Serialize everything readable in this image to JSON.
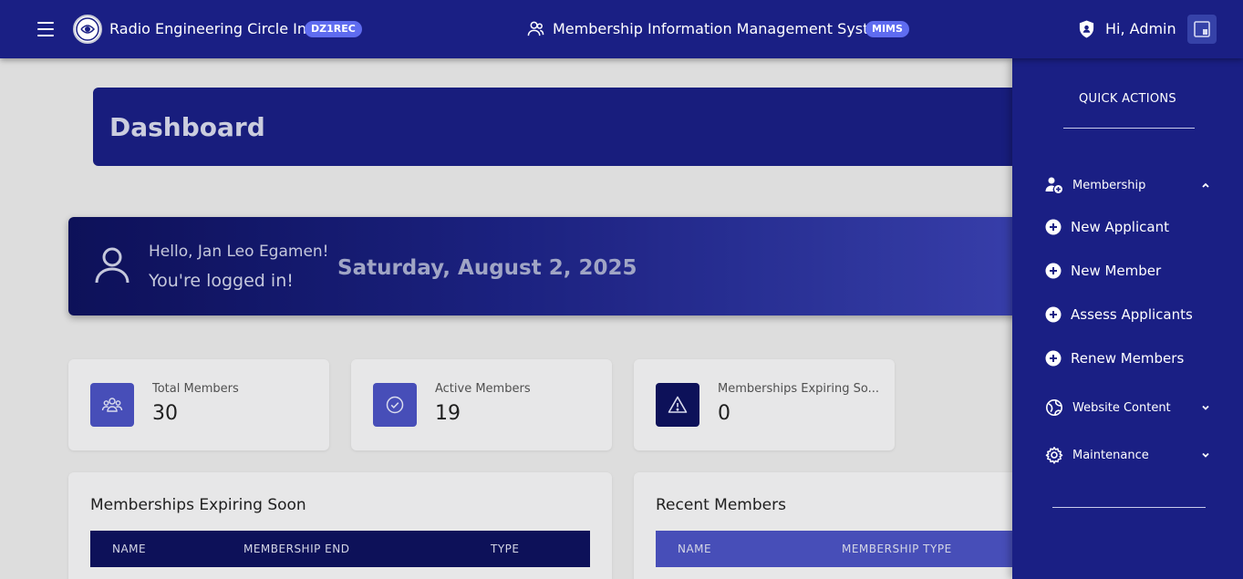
{
  "header": {
    "org_name": "Radio Engineering Circle Inc.",
    "org_badge": "DZ1REC",
    "system_title": "Membership Information Management System",
    "system_badge": "MIMS",
    "greeting": "Hi, Admin"
  },
  "dashboard": {
    "title": "Dashboard",
    "welcome": {
      "hello": "Hello, Jan Leo Egamen!",
      "logged_in": "You're logged in!",
      "date": "Saturday, August 2, 2025"
    },
    "stats": [
      {
        "label": "Total Members",
        "value": "30",
        "icon": "users-icon",
        "color": "#4b53c2"
      },
      {
        "label": "Active Members",
        "value": "19",
        "icon": "check-circle-icon",
        "color": "#4b53c2"
      },
      {
        "label": "Memberships Expiring So...",
        "value": "0",
        "icon": "warning-icon",
        "color": "#0e125e"
      }
    ],
    "expiring_panel": {
      "title": "Memberships Expiring Soon",
      "columns": [
        "NAME",
        "MEMBERSHIP END",
        "TYPE"
      ],
      "header_color": "#0e125e"
    },
    "recent_panel": {
      "title": "Recent Members",
      "columns": [
        "NAME",
        "MEMBERSHIP TYPE"
      ],
      "header_color": "#4b53c2"
    }
  },
  "sidebar": {
    "title": "QUICK ACTIONS",
    "membership": {
      "label": "Membership",
      "icon": "user-plus-icon",
      "expanded": true,
      "items": [
        {
          "label": "New Applicant",
          "icon": "plus-circle-icon"
        },
        {
          "label": "New Member",
          "icon": "plus-circle-icon"
        },
        {
          "label": "Assess Applicants",
          "icon": "plus-circle-icon"
        },
        {
          "label": "Renew Members",
          "icon": "plus-circle-icon"
        }
      ]
    },
    "website_content": {
      "label": "Website Content",
      "icon": "globe-icon",
      "expanded": false
    },
    "maintenance": {
      "label": "Maintenance",
      "icon": "gear-icon",
      "expanded": false
    }
  },
  "colors": {
    "primary": "#1a1f84",
    "accent": "#5f6cf0",
    "dark": "#0e125e"
  }
}
